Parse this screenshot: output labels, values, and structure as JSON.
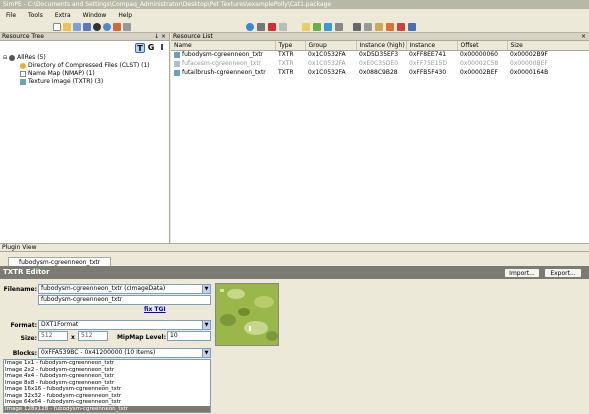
{
  "window": {
    "title": "SimPE - C:\\Documents and Settings\\Compaq_Administrator\\Desktop\\Pet Textures\\examplePolly\\Cat1.package"
  },
  "menu": [
    "File",
    "Tools",
    "Extra",
    "Window",
    "Help"
  ],
  "resource_tree": {
    "title": "Resource Tree",
    "pin": "↓ ×",
    "view_buttons": [
      "T",
      "G",
      "I"
    ],
    "items": [
      {
        "label": "AllRes (5)"
      },
      {
        "label": "Directory of Compressed Files (CLST) (1)"
      },
      {
        "label": "Name Map (NMAP) (1)"
      },
      {
        "label": "Texture Image (TXTR) (3)"
      }
    ]
  },
  "resource_list": {
    "title": "Resource List",
    "pin": "×",
    "columns": [
      "Name",
      "Type",
      "Group",
      "Instance (high)",
      "Instance",
      "Offset",
      "Size"
    ],
    "rows": [
      [
        "fubodysm-cgreenneon_txtr",
        "TXTR",
        "0x1C0532FA",
        "0xD5D35EF3",
        "0xFF8EE741",
        "0x00000060",
        "0x00002B9F"
      ],
      [
        "fufacesm-cgreenneon_txtr",
        "TXTR",
        "0x1C0532FA",
        "0xE0C35DE0",
        "0xFF75E15D",
        "0x00002C58",
        "0x00000BEF"
      ],
      [
        "futailbrush-cgreenneon_txtr",
        "TXTR",
        "0x1C0532FA",
        "0x088C9B28",
        "0xFFB5F430",
        "0x00002BEF",
        "0x0000164B"
      ]
    ]
  },
  "plugin_view": {
    "title": "Plugin View",
    "tab": "fubodysm-cgreenneon_txtr"
  },
  "editor": {
    "title": "TXTR Editor",
    "import": "Import...",
    "export": "Export...",
    "filename_label": "Filename:",
    "filename_value": "fubodysm-cgreenneon_txtr (cImageData)",
    "filename_field": "fubodysm-cgreenneon_txtr",
    "fix_tgi": "fix TGI",
    "format_label": "Format:",
    "format_value": "DXT1Format",
    "size_label": "Size:",
    "size_w": "512",
    "size_x": "x",
    "size_h": "512",
    "mipmap_label": "MipMap Level:",
    "mipmap_value": "10",
    "blocks_label": "Blocks:",
    "blocks_value": "0xFFA539BC - 0x41200000 (10 Items)",
    "blocks": [
      "Image 1x1 - fubodysm-cgreenneon_txtr",
      "Image 2x2 - fubodysm-cgreenneon_txtr",
      "Image 4x4 - fubodysm-cgreenneon_txtr",
      "Image 8x8 - fubodysm-cgreenneon_txtr",
      "Image 16x16 - fubodysm-cgreenneon_txtr",
      "Image 32x32 - fubodysm-cgreenneon_txtr",
      "Image 64x64 - fubodysm-cgreenneon_txtr",
      "Image 128x128 - fubodysm-cgreenneon_txtr"
    ],
    "selected_block": 7
  },
  "colors": {
    "accent": "#316ac5",
    "editor_bar": "#7b7b73",
    "texture_green": "#9ab84a"
  }
}
